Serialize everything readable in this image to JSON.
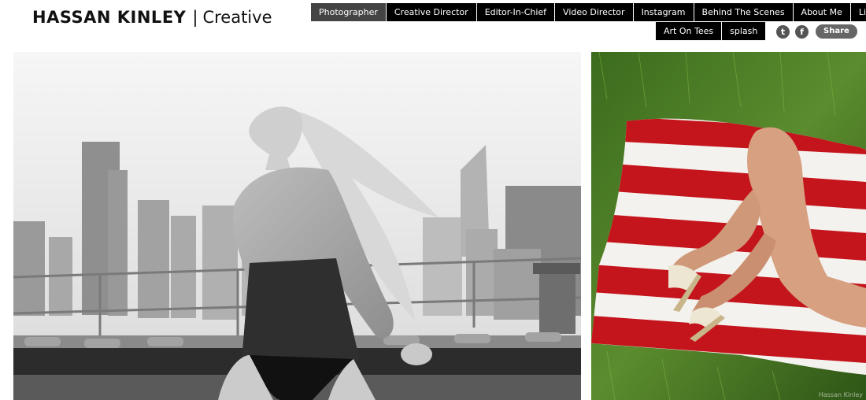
{
  "logo": {
    "name": "HASSAN KINLEY",
    "separator": "|",
    "subtitle": "Creative"
  },
  "nav": {
    "row1": [
      {
        "label": "Photographer",
        "active": true
      },
      {
        "label": "Creative Director",
        "active": false
      },
      {
        "label": "Editor-In-Chief",
        "active": false
      },
      {
        "label": "Video Director",
        "active": false
      },
      {
        "label": "Instagram",
        "active": false
      },
      {
        "label": "Behind The Scenes",
        "active": false
      },
      {
        "label": "About Me",
        "active": false
      },
      {
        "label": "Links",
        "active": false
      }
    ],
    "row2": [
      {
        "label": "Art On Tees",
        "active": false
      },
      {
        "label": "splash",
        "active": false
      }
    ]
  },
  "social": {
    "twitter_icon": "twitter-icon",
    "twitter_glyph": "t",
    "facebook_icon": "facebook-icon",
    "facebook_glyph": "f",
    "share_label": "Share"
  },
  "photos": {
    "photo1_alt": "city-rooftop-portrait",
    "photo2_alt": "striped-blanket-on-grass",
    "watermark": "Hassan Kinley"
  },
  "colors": {
    "nav_bg": "#000000",
    "nav_active_bg": "#444444",
    "nav_text": "#ffffff",
    "stripe_red": "#c4141c"
  }
}
